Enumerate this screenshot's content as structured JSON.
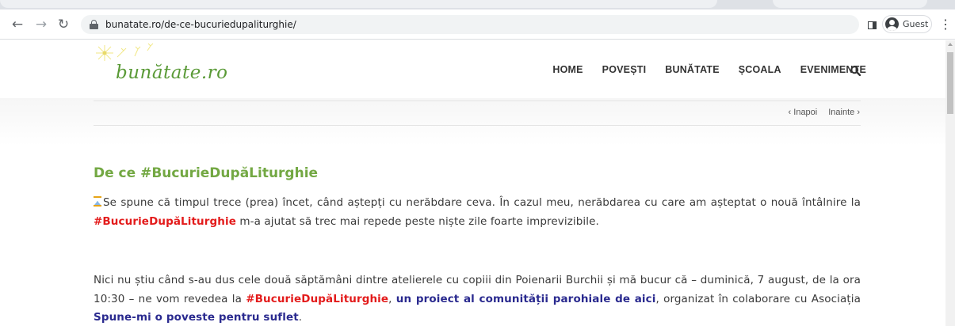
{
  "browser": {
    "url": "bunatate.ro/de-ce-bucuriedupaliturghie/",
    "profile_label": "Guest"
  },
  "site": {
    "logo_text": "bunătate.ro",
    "nav": [
      "HOME",
      "POVEȘTI",
      "BUNĂTATE",
      "ȘCOALA",
      "EVENIMENTE"
    ]
  },
  "post_nav": {
    "prev": "‹ Inapoi",
    "next": "Inainte ›"
  },
  "article": {
    "title": "De ce #BucurieDupăLiturghie",
    "p1": {
      "before": "Se spune că timpul trece (prea) încet, când aștepți cu nerăbdare ceva. În cazul meu, nerăbdarea cu care am așteptat o nouă întâlnire la ",
      "tag": "#BucurieDupăLiturghie",
      "after": " m-a ajutat să trec mai repede peste niște zile foarte imprevizibile."
    },
    "p2": {
      "before": "Nici nu știu când s-au dus cele două săptămâni dintre atelierele cu copiii din Poienarii Burchii și mă bucur că – duminică, 7 august, de la ora 10:30 – ne vom revedea la ",
      "tag": "#BucurieDupăLiturghie",
      "comma": ", ",
      "link1": "un proiect al comunității parohiale de aici",
      "middle": ", organizat în colaborare cu Asociația ",
      "link2": "Spune-mi o poveste pentru suflet",
      "end": "."
    }
  },
  "colors": {
    "accent_green": "#73a843",
    "hashtag_red": "#e31b1b",
    "link_blue": "#2a2a8f"
  }
}
